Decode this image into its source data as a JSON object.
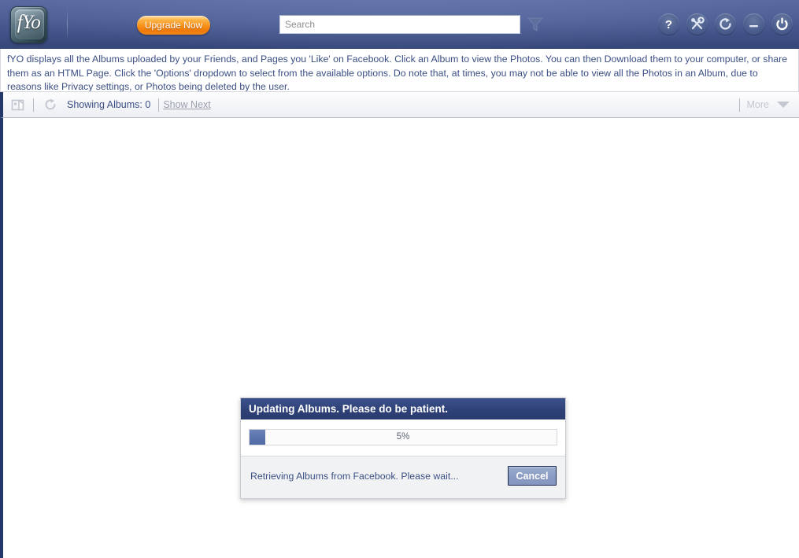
{
  "app": {
    "logo_text": "fYo"
  },
  "header": {
    "upgrade_label": "Upgrade Now",
    "search": {
      "value": "",
      "placeholder": "Search"
    },
    "filter_icon": "funnel-filter-icon",
    "icons": [
      {
        "name": "help-icon",
        "glyph": "?"
      },
      {
        "name": "tools-icon",
        "glyph": "tools"
      },
      {
        "name": "refresh-icon",
        "glyph": "refresh"
      },
      {
        "name": "minimize-icon",
        "glyph": "minimize"
      },
      {
        "name": "power-icon",
        "glyph": "power"
      }
    ],
    "accent_color": "#f7901a",
    "background_color": "#46578e"
  },
  "description": {
    "text": "fYO displays all the Albums uploaded by your Friends, and Pages you 'Like' on Facebook. Click an Album to view the Photos. You can then Download them to your computer, or share them as an HTML Page. Click the 'Options' dropdown to select from the available options. Do note that, at times, you may not be able to view all the Photos in an Album, due to reasons like Privacy settings, or Photos being deleted by the user."
  },
  "toolbar": {
    "upload_icon": "upload-share-icon",
    "refresh_icon": "refresh-icon",
    "showing_albums_label": "Showing Albums: 0",
    "show_next_label": "Show Next",
    "more_label": "More",
    "caret_icon": "chevron-down-icon"
  },
  "dialog": {
    "title": "Updating Albums. Please do be patient.",
    "progress_percent_label": "5%",
    "progress_percent": 5,
    "status_text": "Retrieving Albums from Facebook. Please wait...",
    "cancel_label": "Cancel",
    "title_color": "#2e4076",
    "progress_fill_color": "#5b74ad"
  }
}
